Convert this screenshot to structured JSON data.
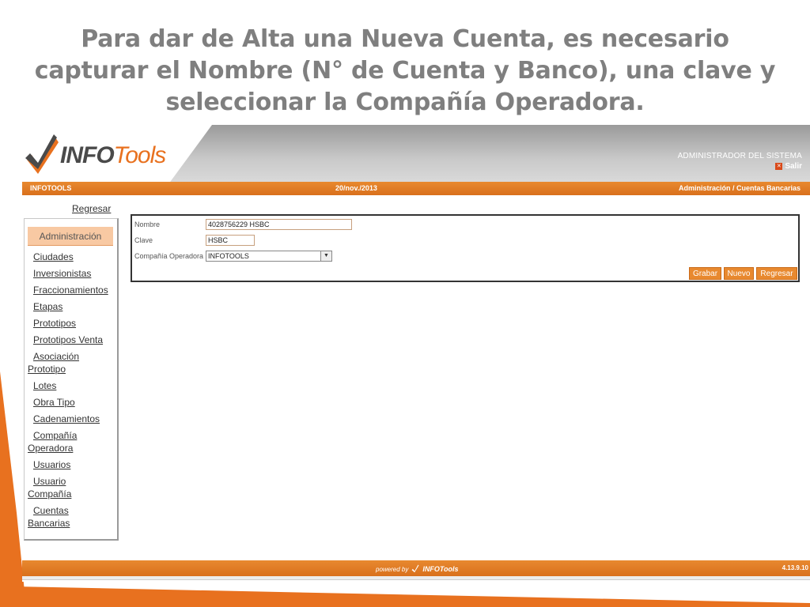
{
  "slide": {
    "title": "Para dar de Alta una Nueva Cuenta, es necesario capturar el Nombre (N° de Cuenta y Banco), una clave y seleccionar la Compañía Operadora."
  },
  "colors": {
    "accent": "#e8711f",
    "header_gray": "#9a9a9a"
  },
  "header": {
    "logo_part1": "INFO",
    "logo_part2": "Tools",
    "admin_label": "ADMINISTRADOR DEL SISTEMA",
    "salir_label": "Salir",
    "salir_icon": "close-icon"
  },
  "bar": {
    "app_name": "INFOTOOLS",
    "date": "20/nov./2013",
    "breadcrumb": "Administración / Cuentas Bancarias"
  },
  "sidebar": {
    "regresar": "Regresar",
    "heading": "Administración",
    "items": [
      {
        "l1": "Ciudades"
      },
      {
        "l1": "Inversionistas"
      },
      {
        "l1": "Fraccionamientos"
      },
      {
        "l1": "Etapas"
      },
      {
        "l1": "Prototipos"
      },
      {
        "l1": "Prototipos Venta"
      },
      {
        "l1": "Asociación",
        "l2": "Prototipo"
      },
      {
        "l1": "Lotes"
      },
      {
        "l1": "Obra Tipo"
      },
      {
        "l1": "Cadenamientos"
      },
      {
        "l1": "Compañía",
        "l2": "Operadora"
      },
      {
        "l1": "Usuarios"
      },
      {
        "l1": "Usuario",
        "l2": "Compañía"
      },
      {
        "l1": "Cuentas",
        "l2": "Bancarias"
      }
    ]
  },
  "form": {
    "nombre_label": "Nombre",
    "nombre_value": "4028756229 HSBC",
    "clave_label": "Clave",
    "clave_value": "HSBC",
    "compania_label": "Compañía Operadora",
    "compania_value": "INFOTOOLS",
    "buttons": {
      "grabar": "Grabar",
      "nuevo": "Nuevo",
      "regresar": "Regresar"
    }
  },
  "footer": {
    "powered_by": "powered by",
    "powered_logo": "INFOTools",
    "version": "4.13.9.10"
  }
}
